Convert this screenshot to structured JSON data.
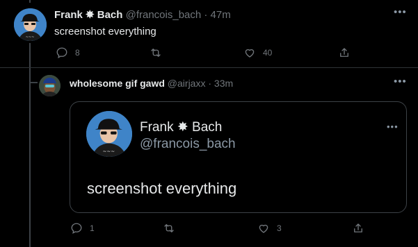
{
  "tweet": {
    "author_name": "Frank ✸ Bach",
    "handle_time": "@francois_bach · 47m",
    "text": "screenshot everything",
    "reply_count": "8",
    "retweet_count": "",
    "like_count": "40"
  },
  "reply": {
    "author_name": "wholesome gif gawd",
    "handle_time": "@airjaxx · 33m",
    "reply_count": "1",
    "retweet_count": "",
    "like_count": "3",
    "card": {
      "author_name": "Frank ✸ Bach",
      "handle": "@francois_bach",
      "text": "screenshot everything"
    }
  },
  "icons": [
    "reply-icon",
    "retweet-icon",
    "like-icon",
    "share-icon",
    "more-icon"
  ],
  "colors": {
    "background": "#000000",
    "text": "#e7e9ea",
    "muted": "#71767b",
    "avatar_blue": "#3f84c8"
  }
}
